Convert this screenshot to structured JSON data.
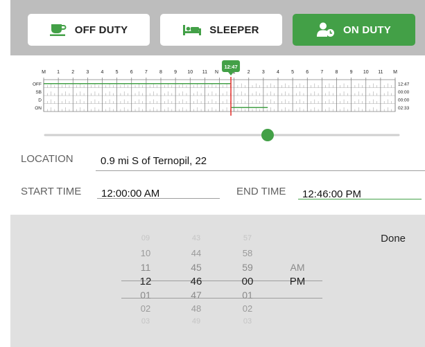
{
  "status_buttons": {
    "off_duty": "OFF DUTY",
    "sleeper": "SLEEPER",
    "on_duty": "ON DUTY"
  },
  "graph": {
    "hour_labels": [
      "M",
      "1",
      "2",
      "3",
      "4",
      "5",
      "6",
      "7",
      "8",
      "9",
      "10",
      "11",
      "N",
      "1",
      "2",
      "3",
      "4",
      "5",
      "6",
      "7",
      "8",
      "9",
      "10",
      "11",
      "M"
    ],
    "marker_time": "12:47",
    "rows": [
      {
        "label": "OFF",
        "total": "12:47"
      },
      {
        "label": "SB",
        "total": "00:00"
      },
      {
        "label": "D",
        "total": "00:00"
      },
      {
        "label": "ON",
        "total": "02:33"
      }
    ],
    "slider_value_fraction": 0.5
  },
  "form": {
    "location_label": "LOCATION",
    "location_value": "0.9 mi S of Ternopil, 22",
    "start_label": "START TIME",
    "start_value": "12:00:00 AM",
    "end_label": "END TIME",
    "end_value": "12:46:00 PM"
  },
  "picker": {
    "done_label": "Done",
    "hours": [
      "09",
      "10",
      "11",
      "12",
      "01",
      "02",
      "03"
    ],
    "minutes": [
      "43",
      "44",
      "45",
      "46",
      "47",
      "48",
      "49"
    ],
    "seconds": [
      "57",
      "58",
      "59",
      "00",
      "01",
      "02",
      "03"
    ],
    "ampm": [
      "AM",
      "PM"
    ]
  },
  "colors": {
    "accent": "#43a047",
    "marker_red": "#e53935"
  }
}
